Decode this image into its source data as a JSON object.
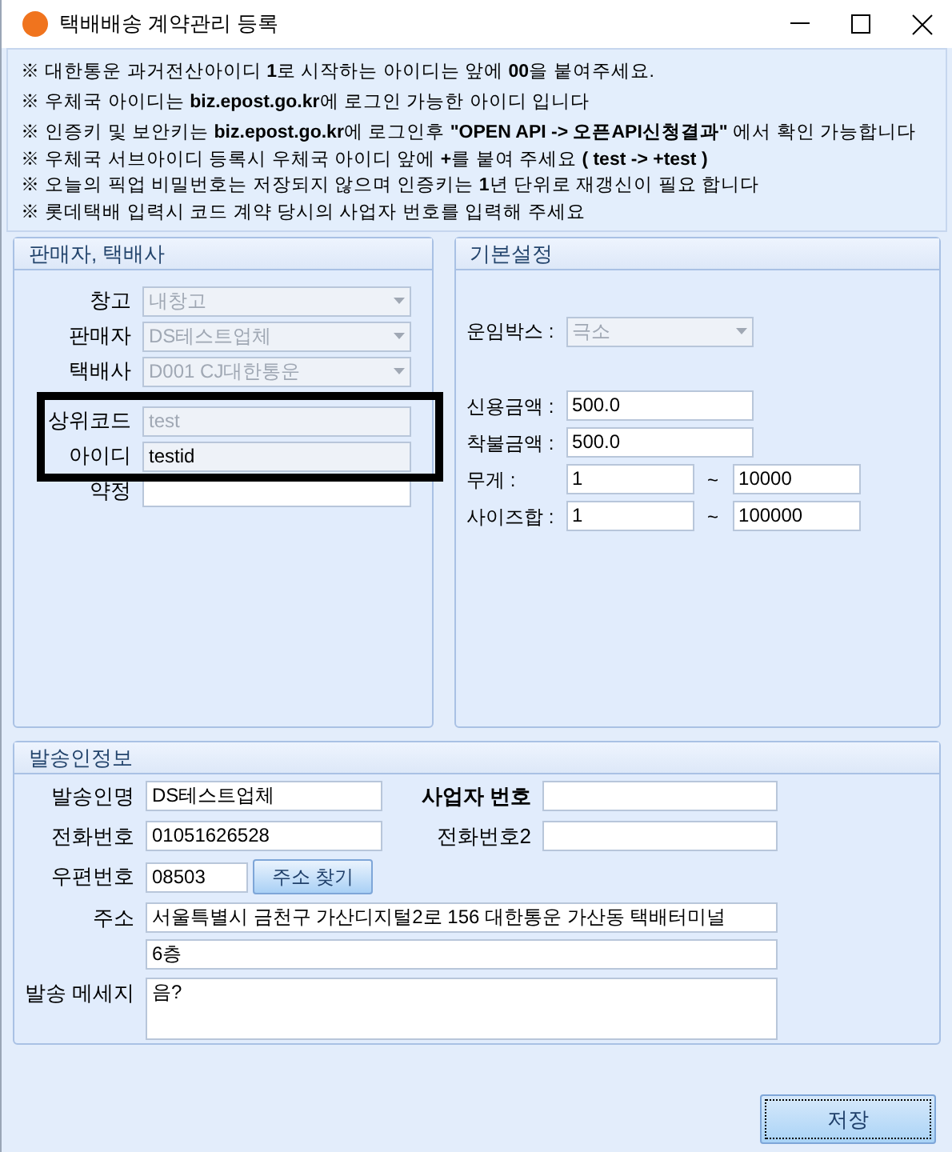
{
  "window": {
    "title": "택배배송 계약관리 등록"
  },
  "notices": [
    "※ 대한통운 과거전산아이디 **1**로 시작하는 아이디는 앞에 **00**을 붙여주세요.",
    "※ 우체국 아이디는 **biz.epost.go.kr**에 로그인 가능한 아이디 입니다",
    "※ 인증키 및 보안키는 **biz.epost.go.kr**에 로그인후 **\"OPEN API -> 오픈API신청결과\"** 에서 확인 가능합니다",
    "※ 우체국 서브아이디 등록시 우체국 아이디 앞에 **+**를 붙여 주세요  **( test -> +test )**",
    "※ 오늘의 픽업 비밀번호는 저장되지 않으며 인증키는 **1**년 단위로 재갱신이 필요 합니다",
    "※ 롯데택배 입력시 코드 계약 당시의 사업자 번호를 입력해 주세요"
  ],
  "seller_group": {
    "title": "판매자, 택배사",
    "fields": [
      {
        "label": "창고",
        "kind": "combo",
        "value": "내창고",
        "disabled": true
      },
      {
        "label": "판매자",
        "kind": "combo",
        "value": "DS테스트업체",
        "disabled": true
      },
      {
        "label": "택배사",
        "kind": "combo",
        "value": "D001 CJ대한통운",
        "disabled": true
      },
      {
        "label": "상위코드",
        "kind": "text",
        "value": "test",
        "disabled": true
      },
      {
        "label": "아이디",
        "kind": "text",
        "value": "testid",
        "disabled": false,
        "readonly": true
      },
      {
        "label": "약정",
        "kind": "text",
        "disabled": false,
        "readonly": false
      }
    ]
  },
  "settings_group": {
    "title": "기본설정",
    "freight_box": {
      "label": "운임박스 :",
      "value": "극소",
      "disabled": true
    },
    "credit_amount": {
      "label": "신용금액 :",
      "value": "500.0"
    },
    "cod_amount": {
      "label": "착불금액 :",
      "value": "500.0"
    },
    "ranges": [
      {
        "label": "무게 :",
        "from": "1",
        "separator": "~",
        "to": "10000"
      },
      {
        "label": "사이즈합 :",
        "from": "1",
        "separator": "~",
        "to": "100000"
      }
    ]
  },
  "sender_group": {
    "title": "발송인정보",
    "sender_name": {
      "label": "발송인명",
      "value": "DS테스트업체"
    },
    "business_number": {
      "label": "사업자 번호"
    },
    "phone": {
      "label": "전화번호",
      "value": "01051626528"
    },
    "phone2": {
      "label": "전화번호2"
    },
    "postcode": {
      "label": "우편번호",
      "value": "08503",
      "button": "주소 찾기"
    },
    "address": {
      "label": "주소",
      "line1": "서울특별시 금천구 가산디지털2로 156 대한통운 가산동 택배터미널",
      "line2": "6층"
    },
    "message": {
      "label": "발송 메세지",
      "value": "음?"
    }
  },
  "buttons": [
    {
      "label": "저장",
      "focused": true
    }
  ]
}
